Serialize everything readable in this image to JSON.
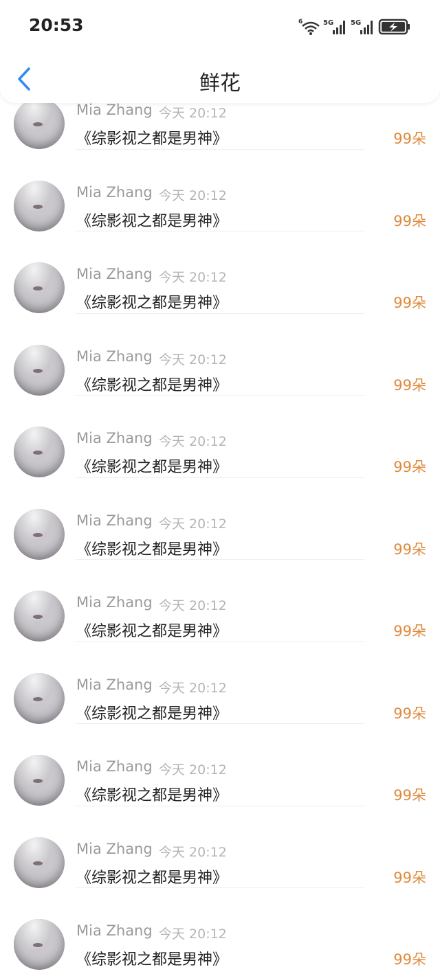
{
  "status_bar": {
    "time": "20:53",
    "network_labels": [
      "6",
      "5G",
      "5G"
    ]
  },
  "nav": {
    "title": "鲜花",
    "back_icon": "chevron-left-icon"
  },
  "items": [
    {
      "name": "Mia Zhang",
      "time": "今天 20:12",
      "book": "《综影视之都是男神》",
      "count": "99朵"
    },
    {
      "name": "Mia Zhang",
      "time": "今天 20:12",
      "book": "《综影视之都是男神》",
      "count": "99朵"
    },
    {
      "name": "Mia Zhang",
      "time": "今天 20:12",
      "book": "《综影视之都是男神》",
      "count": "99朵"
    },
    {
      "name": "Mia Zhang",
      "time": "今天 20:12",
      "book": "《综影视之都是男神》",
      "count": "99朵"
    },
    {
      "name": "Mia Zhang",
      "time": "今天 20:12",
      "book": "《综影视之都是男神》",
      "count": "99朵"
    },
    {
      "name": "Mia Zhang",
      "time": "今天 20:12",
      "book": "《综影视之都是男神》",
      "count": "99朵"
    },
    {
      "name": "Mia Zhang",
      "time": "今天 20:12",
      "book": "《综影视之都是男神》",
      "count": "99朵"
    },
    {
      "name": "Mia Zhang",
      "time": "今天 20:12",
      "book": "《综影视之都是男神》",
      "count": "99朵"
    },
    {
      "name": "Mia Zhang",
      "time": "今天 20:12",
      "book": "《综影视之都是男神》",
      "count": "99朵"
    },
    {
      "name": "Mia Zhang",
      "time": "今天 20:12",
      "book": "《综影视之都是男神》",
      "count": "99朵"
    },
    {
      "name": "Mia Zhang",
      "time": "今天 20:12",
      "book": "《综影视之都是男神》",
      "count": "99朵"
    }
  ],
  "colors": {
    "accent": "#2d8cf0",
    "count": "#e08a3c",
    "name": "#9a9a9a",
    "time": "#b4b4b4"
  }
}
